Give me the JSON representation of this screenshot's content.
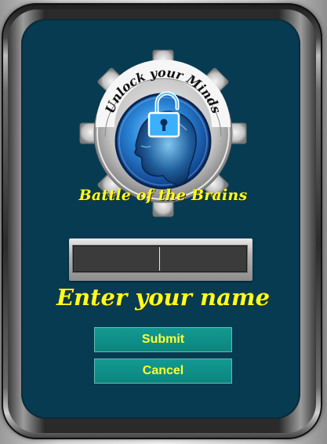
{
  "logo": {
    "arc_text": "Unlock your Minds",
    "title": "Battle of the Brains",
    "icons": [
      "gear-icon",
      "head-icon",
      "padlock-open-icon"
    ],
    "colors": {
      "gear": "#bdbdbd",
      "globe": "#1e78d2",
      "title": "#ffff20"
    }
  },
  "name_field": {
    "value": "",
    "placeholder": ""
  },
  "prompt": "Enter your name",
  "buttons": {
    "submit_label": "Submit",
    "cancel_label": "Cancel"
  },
  "colors": {
    "panel": "#073b52",
    "button": "#0f928a",
    "button_text": "#ffff33"
  }
}
